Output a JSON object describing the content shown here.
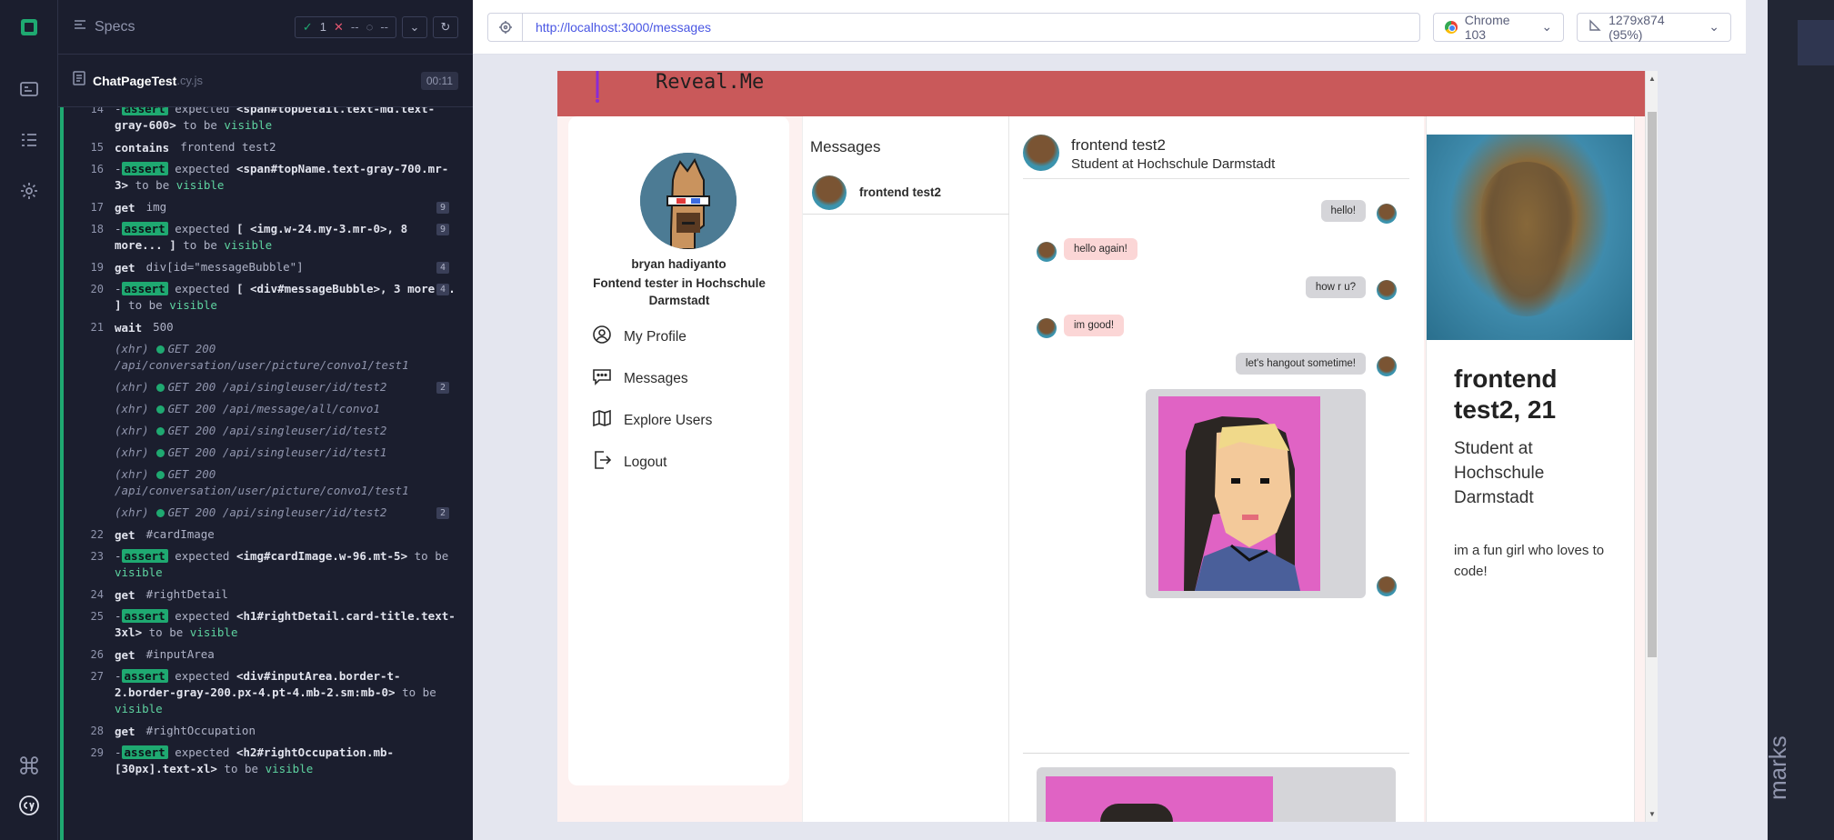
{
  "reporter": {
    "specs_label": "Specs",
    "stats": {
      "passed": "1",
      "failed": "--",
      "pending": "--"
    },
    "spec_name": "ChatPageTest",
    "spec_ext": ".cy.js",
    "duration": "00:11"
  },
  "commands": [
    {
      "num": "14",
      "kind": "assert",
      "text": "expected <span#topDetail.text-md.text-gray-600> to be visible"
    },
    {
      "num": "15",
      "kind": "cmd",
      "name": "contains",
      "text": "frontend test2"
    },
    {
      "num": "16",
      "kind": "assert",
      "text": "expected <span#topName.text-gray-700.mr-3> to be visible"
    },
    {
      "num": "17",
      "kind": "cmd",
      "name": "get",
      "text": "img",
      "badge": "9"
    },
    {
      "num": "18",
      "kind": "assert",
      "text": "expected [ <img.w-24.my-3.mr-0>, 8 more... ] to be visible",
      "badge": "9"
    },
    {
      "num": "19",
      "kind": "cmd",
      "name": "get",
      "text": "div[id=\"messageBubble\"]",
      "badge": "4"
    },
    {
      "num": "20",
      "kind": "assert",
      "text": "expected [ <div#messageBubble>, 3 more... ] to be visible",
      "badge": "4"
    },
    {
      "num": "21",
      "kind": "cmd",
      "name": "wait",
      "text": "500"
    },
    {
      "kind": "xhr",
      "text": "GET 200 /api/conversation/user/picture/convo1/test1"
    },
    {
      "kind": "xhr",
      "text": "GET 200 /api/singleuser/id/test2",
      "badge": "2",
      "chevron": true
    },
    {
      "kind": "xhr",
      "text": "GET 200 /api/message/all/convo1"
    },
    {
      "kind": "xhr",
      "text": "GET 200 /api/singleuser/id/test2"
    },
    {
      "kind": "xhr",
      "text": "GET 200 /api/singleuser/id/test1"
    },
    {
      "kind": "xhr",
      "text": "GET 200 /api/conversation/user/picture/convo1/test1"
    },
    {
      "kind": "xhr",
      "text": "GET 200 /api/singleuser/id/test2",
      "badge": "2",
      "chevron": true
    },
    {
      "num": "22",
      "kind": "cmd",
      "name": "get",
      "text": "#cardImage"
    },
    {
      "num": "23",
      "kind": "assert",
      "text": "expected <img#cardImage.w-96.mt-5> to be visible"
    },
    {
      "num": "24",
      "kind": "cmd",
      "name": "get",
      "text": "#rightDetail"
    },
    {
      "num": "25",
      "kind": "assert",
      "text": "expected <h1#rightDetail.card-title.text-3xl> to be visible"
    },
    {
      "num": "26",
      "kind": "cmd",
      "name": "get",
      "text": "#inputArea"
    },
    {
      "num": "27",
      "kind": "assert",
      "text": "expected <div#inputArea.border-t-2.border-gray-200.px-4.pt-4.mb-2.sm:mb-0> to be visible"
    },
    {
      "num": "28",
      "kind": "cmd",
      "name": "get",
      "text": "#rightOccupation"
    },
    {
      "num": "29",
      "kind": "assert",
      "text": "expected <h2#rightOccupation.mb-[30px].text-xl> to be visible"
    }
  ],
  "labels": {
    "assert": "assert",
    "xhr": "(xhr)",
    "to_be": "to be",
    "visible": "visible"
  },
  "browser": {
    "url": "http://localhost:3000/messages",
    "name": "Chrome 103",
    "viewport": "1279x874 (95%)"
  },
  "app": {
    "brand": "Reveal.Me",
    "colors": {
      "header": "#c9595a",
      "bubble_me": "#d5d5d9",
      "bubble_them": "#fbd6d6"
    },
    "profile": {
      "name": "bryan hadiyanto",
      "bio": "Fontend tester in Hochschule Darmstadt"
    },
    "nav": [
      {
        "label": "My Profile",
        "icon": "user-circle-icon"
      },
      {
        "label": "Messages",
        "icon": "chat-icon"
      },
      {
        "label": "Explore Users",
        "icon": "map-icon"
      },
      {
        "label": "Logout",
        "icon": "logout-icon"
      }
    ],
    "conversations_title": "Messages",
    "conversation": {
      "name": "frontend test2"
    },
    "chat_header": {
      "name": "frontend test2",
      "occupation": "Student at Hochschule Darmstadt"
    },
    "messages": [
      {
        "from": "me",
        "text": "hello!"
      },
      {
        "from": "them",
        "text": "hello again!"
      },
      {
        "from": "me",
        "text": "how r u?"
      },
      {
        "from": "them",
        "text": "im good!"
      },
      {
        "from": "me",
        "text": "let's hangout sometime!"
      }
    ],
    "card": {
      "title": "frontend test2, 21",
      "occupation": "Student at Hochschule Darmstadt",
      "bio": "im a fun girl who loves to code!"
    }
  },
  "side_label": "marks"
}
